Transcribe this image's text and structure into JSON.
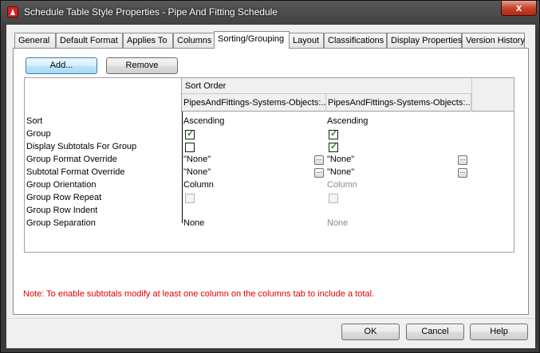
{
  "window": {
    "title": "Schedule Table Style Properties - Pipe And Fitting Schedule",
    "close_label": "x"
  },
  "tabs": [
    "General",
    "Default Format",
    "Applies To",
    "Columns",
    "Sorting/Grouping",
    "Layout",
    "Classifications",
    "Display Properties",
    "Version History"
  ],
  "active_tab": "Sorting/Grouping",
  "toolbar": {
    "add_label": "Add...",
    "remove_label": "Remove"
  },
  "grid": {
    "header": "Sort Order",
    "columns": [
      "PipesAndFittings-Systems-Objects:...",
      "PipesAndFittings-Systems-Objects:..."
    ],
    "rows": [
      {
        "label": "Sort",
        "col1": "Ascending",
        "col2": "Ascending"
      },
      {
        "label": "Group",
        "col1_checked": true,
        "col2_checked": true
      },
      {
        "label": "Display Subtotals For Group",
        "col1_checked": false,
        "col2_checked": true
      },
      {
        "label": "Group Format Override",
        "col1": "\"None\"",
        "col2": "\"None\"",
        "ellipsis": "..."
      },
      {
        "label": "Subtotal Format Override",
        "col1": "\"None\"",
        "col2": "\"None\"",
        "ellipsis": "..."
      },
      {
        "label": "Group Orientation",
        "col1": "Column",
        "col2": "Column"
      },
      {
        "label": "Group Row Repeat",
        "col1_checked": false,
        "col2_checked": false
      },
      {
        "label": "Group Row Indent"
      },
      {
        "label": "Group Separation",
        "col1": "None",
        "col2": "None"
      }
    ]
  },
  "note": "Note: To enable subtotals modify at least one column on the columns tab to include a total.",
  "footer": {
    "ok_label": "OK",
    "cancel_label": "Cancel",
    "help_label": "Help"
  },
  "colors": {
    "note": "#e00000",
    "checkmark": "#1a8c1a"
  },
  "icons": [
    "app-icon",
    "close-icon",
    "checkbox",
    "ellipsis-button"
  ]
}
